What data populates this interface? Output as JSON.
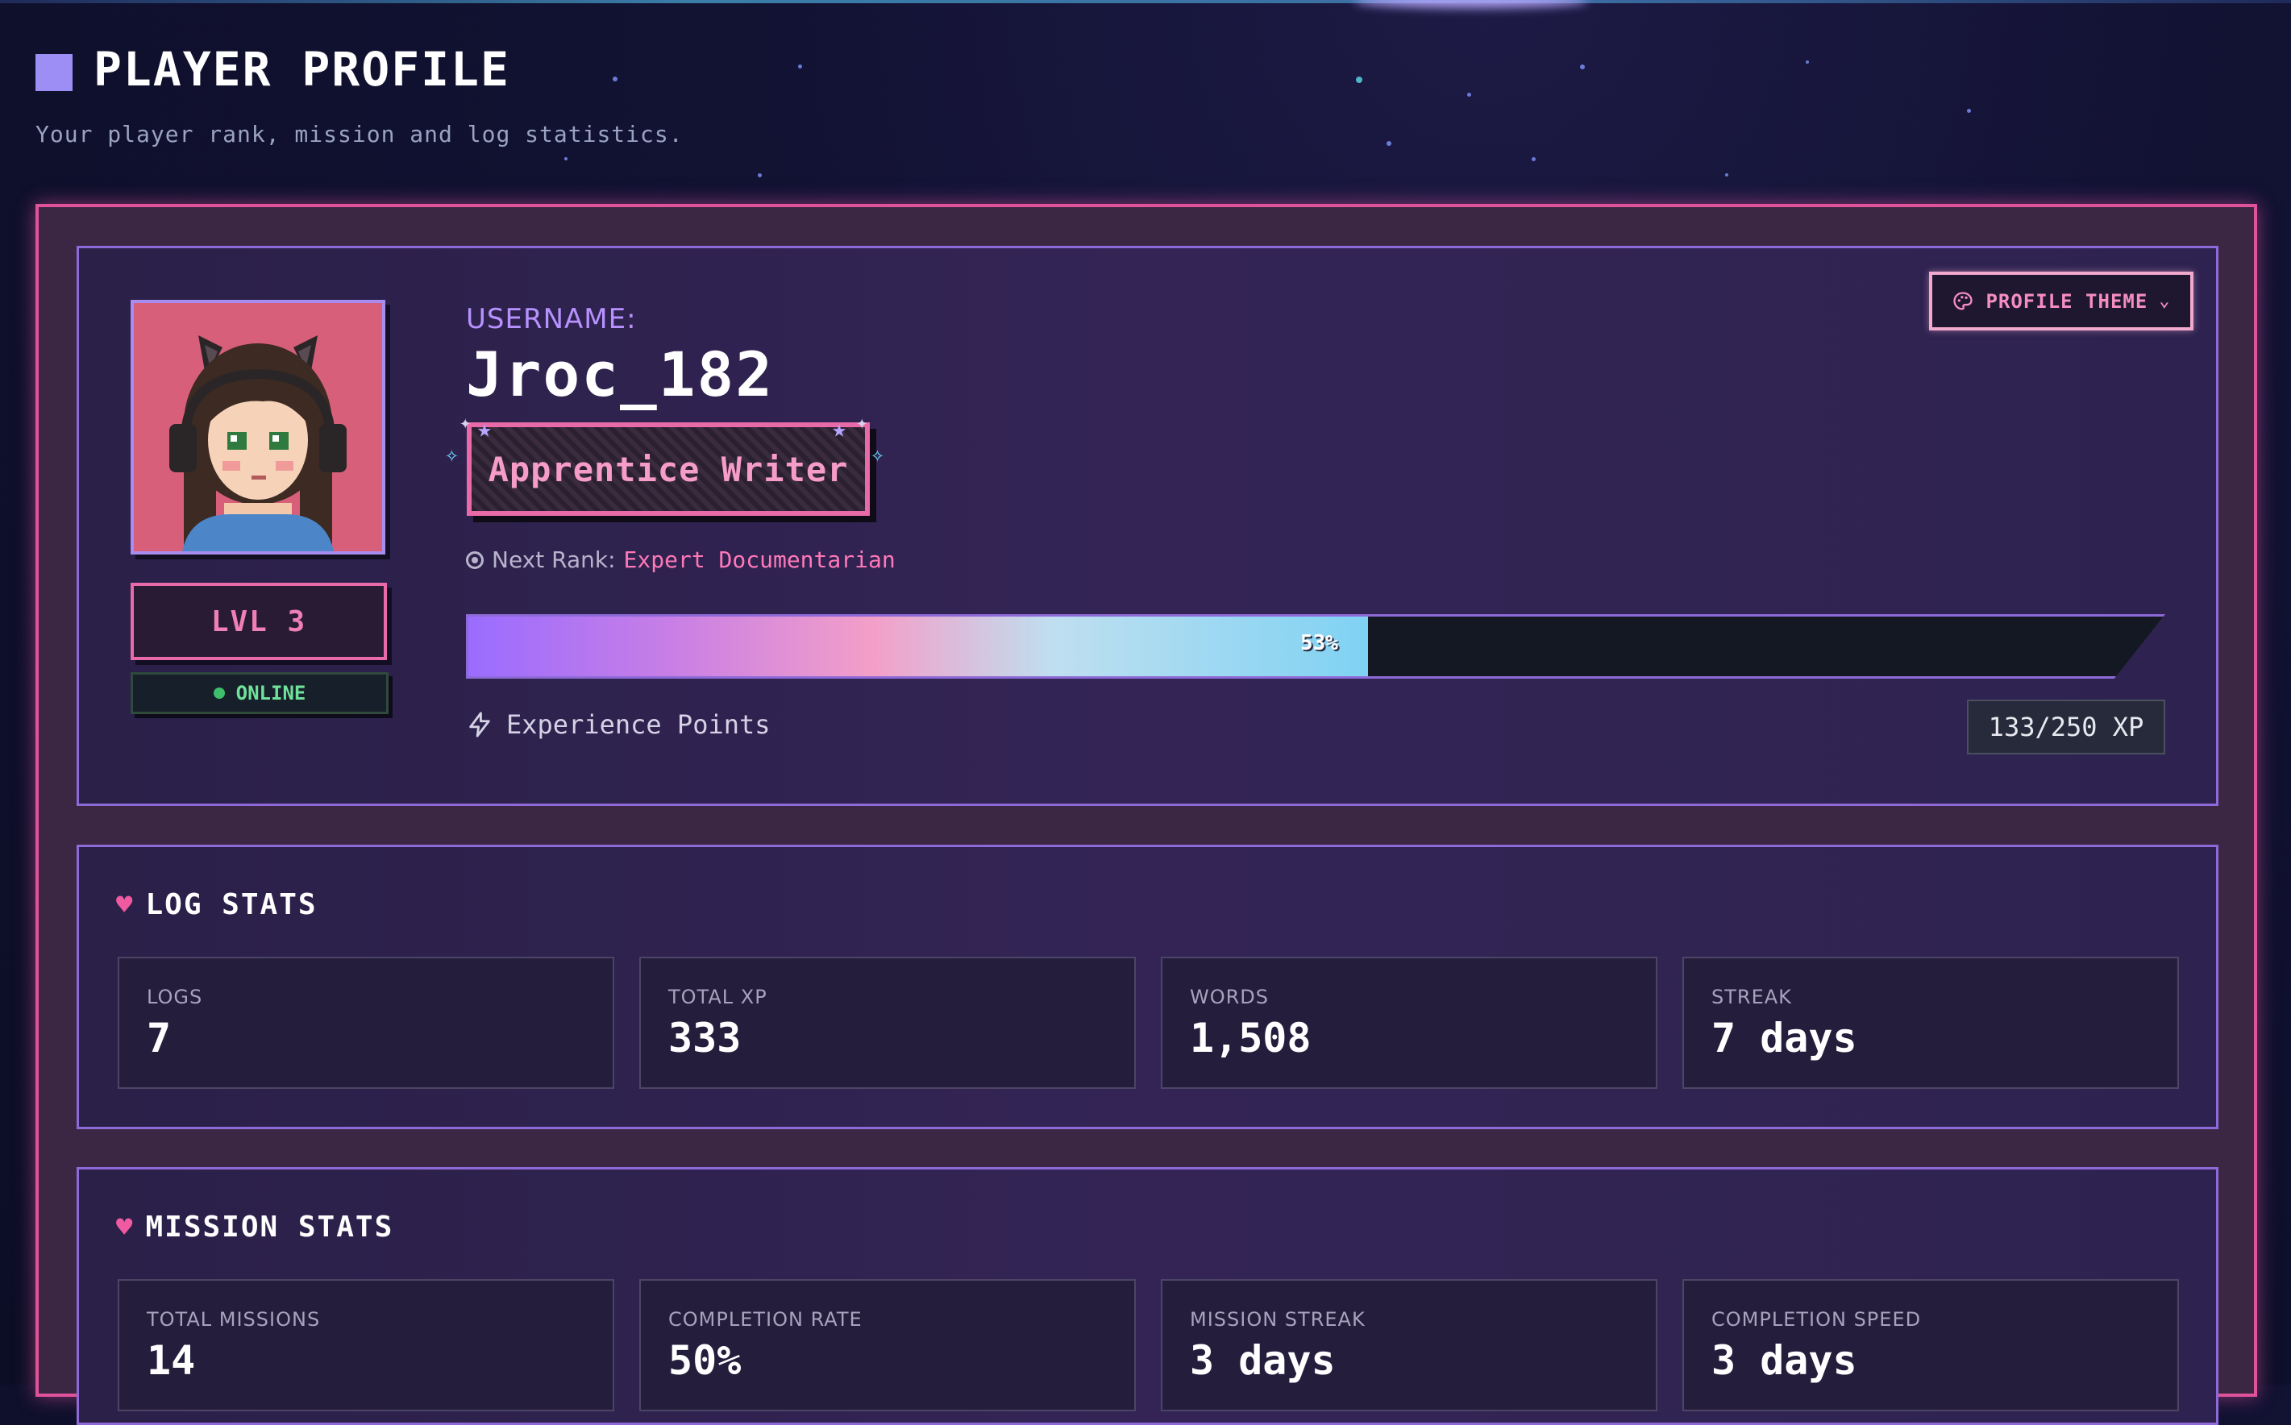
{
  "header": {
    "title": "PLAYER PROFILE",
    "subtitle": "Your player rank, mission and log statistics."
  },
  "profile": {
    "username_label": "USERNAME:",
    "username": "Jroc_182",
    "rank": "Apprentice Writer",
    "next_rank_label": "Next Rank:",
    "next_rank_value": "Expert Documentarian",
    "level": "LVL 3",
    "status": "ONLINE",
    "theme_button": "PROFILE THEME",
    "xp_percent_label": "53%",
    "xp_progress": 0.53,
    "xp_label": "Experience Points",
    "xp_value": "133/250 XP"
  },
  "log_stats": {
    "title": "LOG STATS",
    "cards": [
      {
        "label": "LOGS",
        "value": "7"
      },
      {
        "label": "TOTAL XP",
        "value": "333"
      },
      {
        "label": "WORDS",
        "value": "1,508"
      },
      {
        "label": "STREAK",
        "value": "7 days"
      }
    ]
  },
  "mission_stats": {
    "title": "MISSION STATS",
    "cards": [
      {
        "label": "TOTAL MISSIONS",
        "value": "14"
      },
      {
        "label": "COMPLETION RATE",
        "value": "50%"
      },
      {
        "label": "MISSION STREAK",
        "value": "3 days"
      },
      {
        "label": "COMPLETION SPEED",
        "value": "3 days"
      }
    ]
  },
  "colors": {
    "accent_pink": "#e96aa8",
    "accent_purple": "#8e6ad8",
    "online_green": "#6fe19a"
  },
  "icons": {
    "title_icon": "purple-square-icon",
    "theme_icon": "palette-icon",
    "next_rank_icon": "target-icon",
    "xp_icon": "lightning-icon",
    "section_icon": "heart-icon"
  }
}
